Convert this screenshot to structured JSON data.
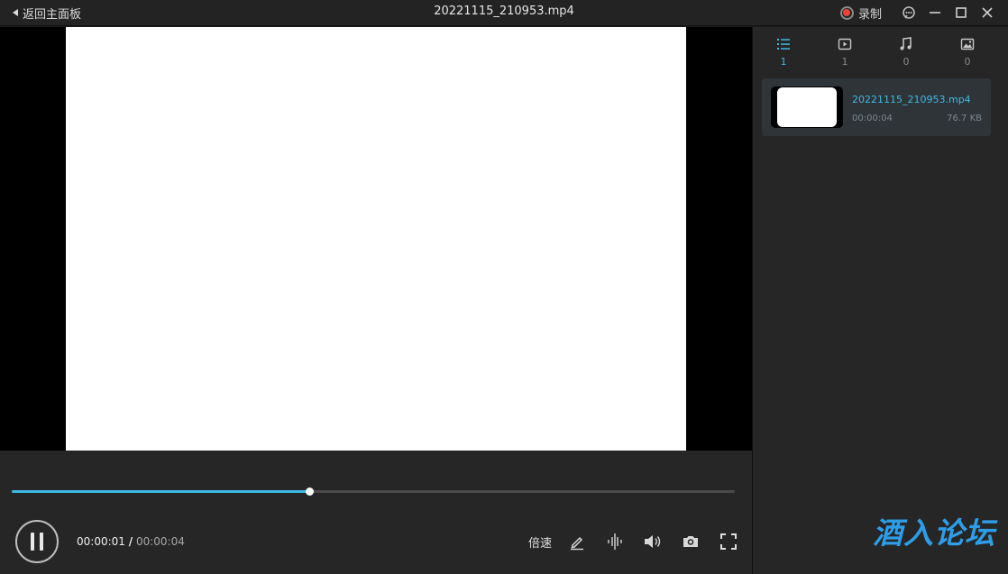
{
  "titlebar": {
    "back_label": "返回主面板",
    "file_title": "20221115_210953.mp4",
    "record_label": "录制"
  },
  "player": {
    "progress_fraction": 0.412,
    "current_time": "00:00:01",
    "separator": "/",
    "duration": "00:00:04",
    "speed_label": "倍速",
    "state": "playing"
  },
  "sidebar": {
    "tabs": [
      {
        "icon": "list-icon",
        "count": "1",
        "active": true
      },
      {
        "icon": "video-icon",
        "count": "1",
        "active": false
      },
      {
        "icon": "music-icon",
        "count": "0",
        "active": false
      },
      {
        "icon": "image-icon",
        "count": "0",
        "active": false
      }
    ],
    "files": [
      {
        "name": "20221115_210953.mp4",
        "duration": "00:00:04",
        "size": "76.7 KB"
      }
    ]
  },
  "watermark": "酒入论坛",
  "colors": {
    "accent": "#3fb9e3",
    "record": "#e8453c",
    "watermark": "#2e9de8"
  }
}
